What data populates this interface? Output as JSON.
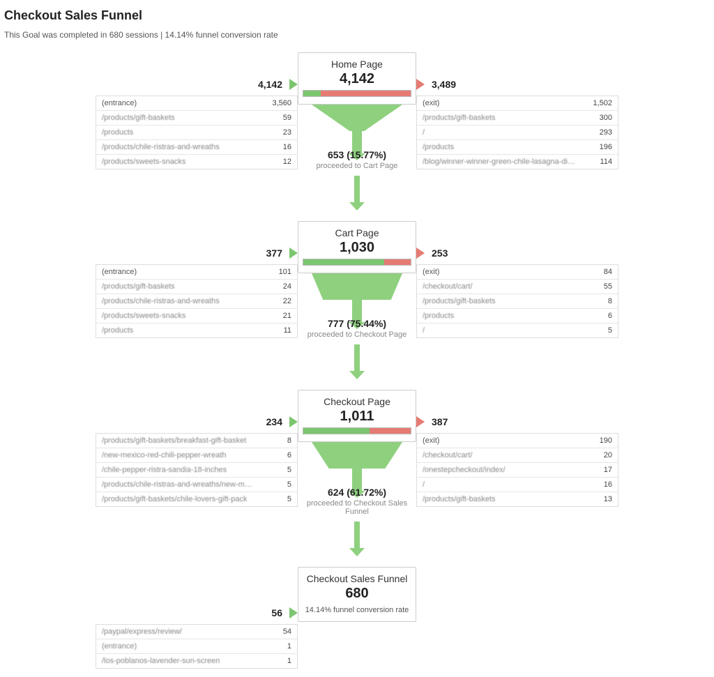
{
  "title": "Checkout Sales Funnel",
  "subtitle": "This Goal was completed in 680 sessions | 14.14% funnel conversion rate",
  "stages": [
    {
      "name": "Home Page",
      "count": "4,142",
      "in": "4,142",
      "out": "3,489",
      "proceed_count": "653 (15.77%)",
      "proceed_label": "proceeded to Cart Page",
      "bar_green_pct": 16,
      "entries": [
        {
          "path": "(entrance)",
          "val": "3,560",
          "noblur": true
        },
        {
          "path": "/products/gift-baskets",
          "val": "59"
        },
        {
          "path": "/products",
          "val": "23"
        },
        {
          "path": "/products/chile-ristras-and-wreaths",
          "val": "16"
        },
        {
          "path": "/products/sweets-snacks",
          "val": "12"
        }
      ],
      "exits": [
        {
          "path": "(exit)",
          "val": "1,502",
          "noblur": true
        },
        {
          "path": "/products/gift-baskets",
          "val": "300"
        },
        {
          "path": "/",
          "val": "293"
        },
        {
          "path": "/products",
          "val": "196"
        },
        {
          "path": "/blog/winner-winner-green-chile-lasagna-dinner/",
          "val": "114"
        }
      ]
    },
    {
      "name": "Cart Page",
      "count": "1,030",
      "in": "377",
      "out": "253",
      "proceed_count": "777 (75.44%)",
      "proceed_label": "proceeded to Checkout Page",
      "bar_green_pct": 75,
      "entries": [
        {
          "path": "(entrance)",
          "val": "101",
          "noblur": true
        },
        {
          "path": "/products/gift-baskets",
          "val": "24"
        },
        {
          "path": "/products/chile-ristras-and-wreaths",
          "val": "22"
        },
        {
          "path": "/products/sweets-snacks",
          "val": "21"
        },
        {
          "path": "/products",
          "val": "11"
        }
      ],
      "exits": [
        {
          "path": "(exit)",
          "val": "84",
          "noblur": true
        },
        {
          "path": "/checkout/cart/",
          "val": "55"
        },
        {
          "path": "/products/gift-baskets",
          "val": "8"
        },
        {
          "path": "/products",
          "val": "6"
        },
        {
          "path": "/",
          "val": "5"
        }
      ]
    },
    {
      "name": "Checkout Page",
      "count": "1,011",
      "in": "234",
      "out": "387",
      "proceed_count": "624 (61.72%)",
      "proceed_label": "proceeded to Checkout Sales Funnel",
      "bar_green_pct": 62,
      "entries": [
        {
          "path": "/products/gift-baskets/breakfast-gift-basket",
          "val": "8"
        },
        {
          "path": "/new-mexico-red-chili-pepper-wreath",
          "val": "6"
        },
        {
          "path": "/chile-pepper-ristra-sandia-18-inches",
          "val": "5"
        },
        {
          "path": "/products/chile-ristras-and-wreaths/new-mexico-r...",
          "val": "5"
        },
        {
          "path": "/products/gift-baskets/chile-lovers-gift-pack",
          "val": "5"
        }
      ],
      "exits": [
        {
          "path": "(exit)",
          "val": "190",
          "noblur": true
        },
        {
          "path": "/checkout/cart/",
          "val": "20"
        },
        {
          "path": "/onestepcheckout/index/",
          "val": "17"
        },
        {
          "path": "/",
          "val": "16"
        },
        {
          "path": "/products/gift-baskets",
          "val": "13"
        }
      ]
    },
    {
      "name": "Checkout Sales Funnel",
      "count": "680",
      "in": "56",
      "out": "",
      "conversion_note": "14.14% funnel conversion rate",
      "entries": [
        {
          "path": "/paypal/express/review/",
          "val": "54"
        },
        {
          "path": "(entrance)",
          "val": "1"
        },
        {
          "path": "/los-poblanos-lavender-sun-screen",
          "val": "1"
        }
      ],
      "exits": []
    }
  ],
  "chart_data": {
    "type": "table",
    "title": "Checkout Sales Funnel",
    "funnel_conversion_rate": 14.14,
    "goal_sessions": 680,
    "steps": [
      {
        "name": "Home Page",
        "sessions": 4142,
        "entries": 4142,
        "exits": 3489,
        "proceeded": 653,
        "proceed_rate_pct": 15.77
      },
      {
        "name": "Cart Page",
        "sessions": 1030,
        "entries": 377,
        "exits": 253,
        "proceeded": 777,
        "proceed_rate_pct": 75.44
      },
      {
        "name": "Checkout Page",
        "sessions": 1011,
        "entries": 234,
        "exits": 387,
        "proceeded": 624,
        "proceed_rate_pct": 61.72
      },
      {
        "name": "Checkout Sales Funnel",
        "sessions": 680,
        "entries": 56
      }
    ]
  }
}
